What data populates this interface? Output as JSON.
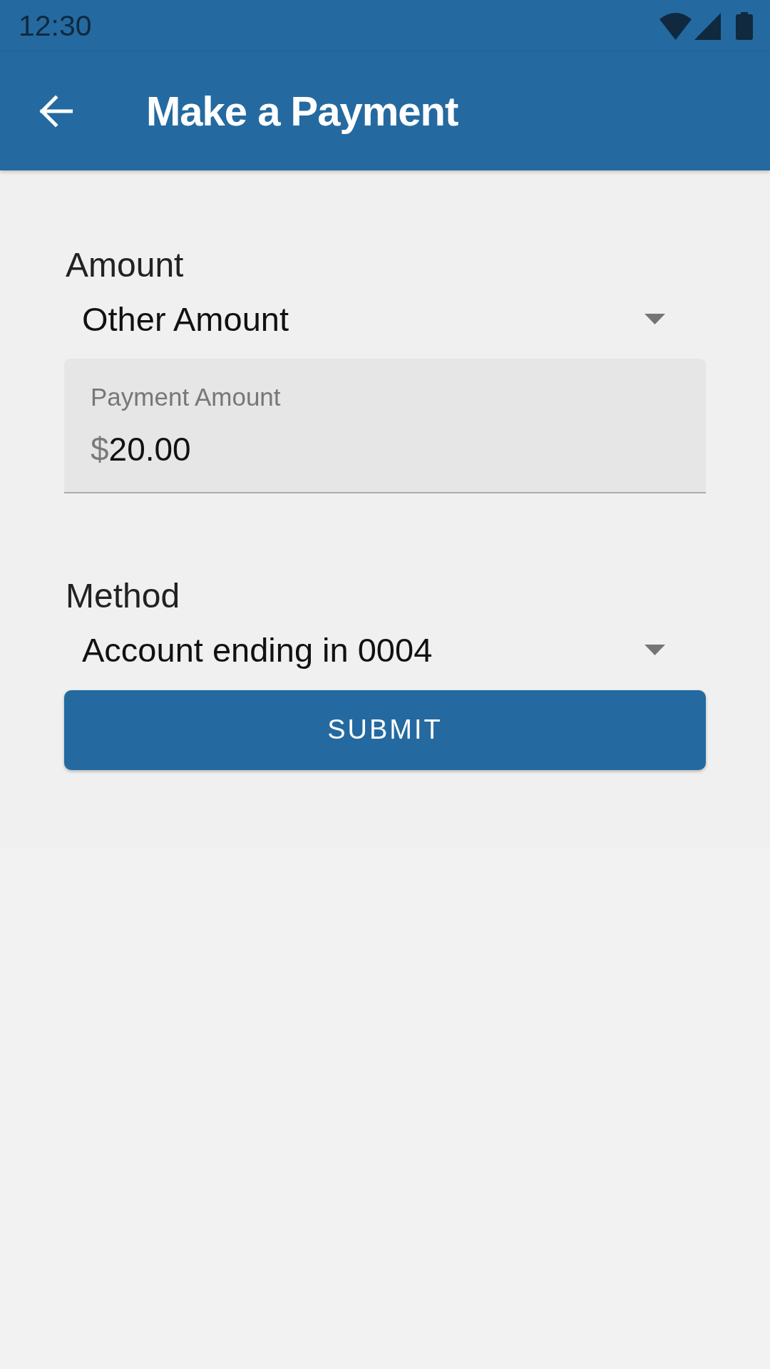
{
  "status_bar": {
    "time": "12:30"
  },
  "app_bar": {
    "title": "Make a Payment"
  },
  "form": {
    "fields": [
      {
        "kind": "dropdown",
        "label": "Amount",
        "value": "Other Amount"
      },
      {
        "kind": "text_input",
        "label": "Payment Amount",
        "prefix": "$",
        "value": "20.00"
      },
      {
        "kind": "dropdown",
        "label": "Method",
        "value": "Account ending in 0004"
      }
    ],
    "submit_button": {
      "label": "SUBMIT"
    }
  }
}
